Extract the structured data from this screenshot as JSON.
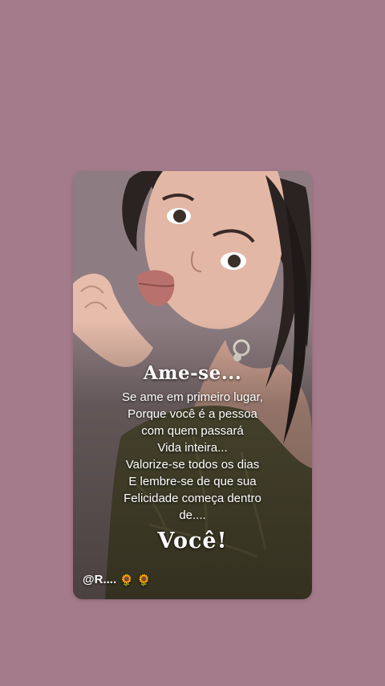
{
  "background_color": "#a47b8b",
  "card": {
    "title": "Ame-se...",
    "lines": [
      "Se ame em primeiro lugar,",
      "Porque você é a pessoa",
      "com quem passará",
      "Vida inteira...",
      "Valorize-se todos os dias",
      "E lembre-se de que sua",
      "Felicidade começa dentro",
      "de...."
    ],
    "signoff": "Você!",
    "handle": "@R....",
    "handle_icons": [
      "sunflower-icon",
      "sunflower-icon"
    ]
  }
}
